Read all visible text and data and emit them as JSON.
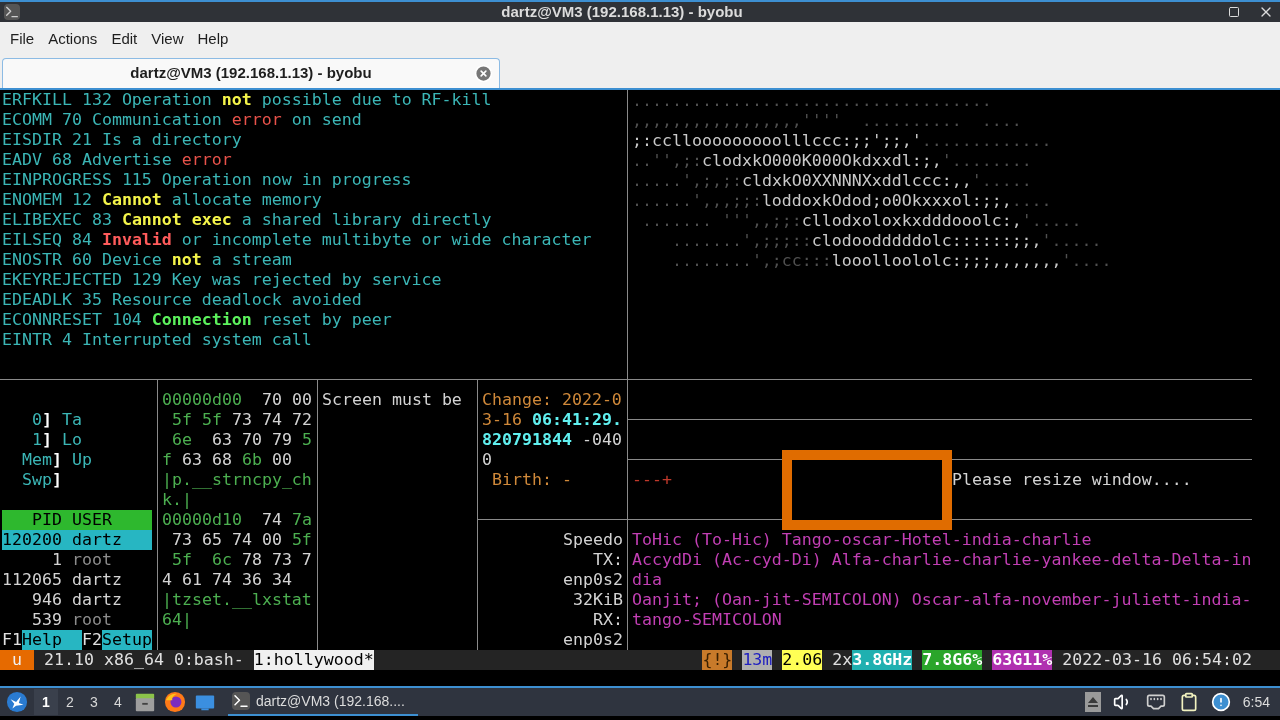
{
  "window": {
    "title": "dartz@VM3 (192.168.1.13) - byobu"
  },
  "menu": [
    "File",
    "Actions",
    "Edit",
    "View",
    "Help"
  ],
  "tabs": [
    {
      "label": "dartz@VM3 (192.168.1.13) - byobu",
      "selected": true
    }
  ],
  "errors": [
    [
      {
        "text": "ERFKILL 132 Operation ",
        "kind": "text"
      },
      {
        "text": "not",
        "kind": "warning"
      },
      {
        "text": " possible due to RF-kill",
        "kind": "text"
      }
    ],
    [
      {
        "text": "ECOMM 70 Communication ",
        "kind": "text"
      },
      {
        "text": "error",
        "kind": "error"
      },
      {
        "text": " on send",
        "kind": "text"
      }
    ],
    [
      {
        "text": "EISDIR 21 Is a directory",
        "kind": "text"
      }
    ],
    [
      {
        "text": "EADV 68 Advertise ",
        "kind": "text"
      },
      {
        "text": "error",
        "kind": "error"
      }
    ],
    [
      {
        "text": "EINPROGRESS 115 Operation now in progress",
        "kind": "text"
      }
    ],
    [
      {
        "text": "ENOMEM 12 ",
        "kind": "text"
      },
      {
        "text": "Cannot",
        "kind": "warning"
      },
      {
        "text": " allocate memory",
        "kind": "text"
      }
    ],
    [
      {
        "text": "ELIBEXEC 83 ",
        "kind": "text"
      },
      {
        "text": "Cannot exec",
        "kind": "warning"
      },
      {
        "text": " a shared library directly",
        "kind": "text"
      }
    ],
    [
      {
        "text": "EILSEQ 84 ",
        "kind": "text"
      },
      {
        "text": "Invalid",
        "kind": "critical"
      },
      {
        "text": " or incomplete multibyte or wide character",
        "kind": "text"
      }
    ],
    [
      {
        "text": "ENOSTR 60 Device ",
        "kind": "text"
      },
      {
        "text": "not",
        "kind": "warning"
      },
      {
        "text": " a stream",
        "kind": "text"
      }
    ],
    [
      {
        "text": "EKEYREJECTED 129 Key was rejected by service",
        "kind": "text"
      }
    ],
    [
      {
        "text": "EDEADLK 35 Resource deadlock avoided",
        "kind": "text"
      }
    ],
    [
      {
        "text": "ECONNRESET 104 ",
        "kind": "text"
      },
      {
        "text": "Connection",
        "kind": "success"
      },
      {
        "text": " reset by peer",
        "kind": "text"
      }
    ],
    [
      {
        "text": "EINTR 4 Interrupted system call",
        "kind": "text"
      }
    ]
  ],
  "art": [
    [
      {
        "text": "....................................",
        "kind": "faint"
      }
    ],
    [
      {
        "text": ",,,,,,,,,,,,,,,,,''''  ..........  ....",
        "kind": "faint"
      }
    ],
    [
      {
        "text": ";:ccllooooooooolllccc:;;';;,'",
        "kind": "shade"
      },
      {
        "text": ".............",
        "kind": "faint"
      }
    ],
    [
      {
        "text": "..'',;:",
        "kind": "faint"
      },
      {
        "text": "clodxkO000K000Okdxxdl:;,",
        "kind": "shade"
      },
      {
        "text": "'........",
        "kind": "faint"
      }
    ],
    [
      {
        "text": ".....',;,;:",
        "kind": "faint"
      },
      {
        "text": "cldxkO0XXNNNXxddlccc:,,",
        "kind": "shade"
      },
      {
        "text": "'.....",
        "kind": "faint"
      }
    ],
    [
      {
        "text": "......',,,;;:",
        "kind": "faint"
      },
      {
        "text": "loddoxkOdod;o0Okxxxol:;;,",
        "kind": "shade"
      },
      {
        "text": "....",
        "kind": "faint"
      }
    ],
    [
      {
        "text": " ....... ''',,;;:",
        "kind": "faint"
      },
      {
        "text": "cllodxoloxkxdddooolc:,",
        "kind": "shade"
      },
      {
        "text": "'.....",
        "kind": "faint"
      }
    ],
    [
      {
        "text": "    .......',;;;::",
        "kind": "faint"
      },
      {
        "text": "clodoodddddolc::::::;;,",
        "kind": "shade"
      },
      {
        "text": "'.....",
        "kind": "faint"
      }
    ],
    [
      {
        "text": "    ........',;cc:::",
        "kind": "faint"
      },
      {
        "text": "looolloololc:;;;,,,,,,,",
        "kind": "shade"
      },
      {
        "text": "'....",
        "kind": "faint"
      }
    ]
  ],
  "htop": {
    "meters": [
      [
        {
          "text": "   0",
          "kind": "text"
        },
        {
          "text": "]",
          "kind": "bracket"
        },
        {
          "text": " Ta",
          "kind": "text"
        }
      ],
      [
        {
          "text": "   1",
          "kind": "text"
        },
        {
          "text": "]",
          "kind": "bracket"
        },
        {
          "text": " Lo",
          "kind": "text"
        }
      ],
      [
        {
          "text": "  Mem",
          "kind": "text"
        },
        {
          "text": "]",
          "kind": "bracket"
        },
        {
          "text": " Up",
          "kind": "text"
        }
      ],
      [
        {
          "text": "  Swp",
          "kind": "text"
        },
        {
          "text": "]",
          "kind": "bracket"
        }
      ]
    ],
    "columns": "   PID USER",
    "processes": [
      {
        "pid": "120200",
        "user": "dartz",
        "selected": true,
        "dim": false
      },
      {
        "pid": "1",
        "user": "root",
        "selected": false,
        "dim": true
      },
      {
        "pid": "112065",
        "user": "dartz",
        "selected": false,
        "dim": false
      },
      {
        "pid": "946",
        "user": "dartz",
        "selected": false,
        "dim": false
      },
      {
        "pid": "539",
        "user": "root",
        "selected": false,
        "dim": true
      }
    ],
    "keys": [
      {
        "key": "F1",
        "label": "Help  "
      },
      {
        "key": "F2",
        "label": "Setup"
      }
    ]
  },
  "hexdump": [
    [
      {
        "text": "00000d00",
        "kind": "hex"
      },
      {
        "text": "  70 00",
        "kind": "plain"
      }
    ],
    [
      {
        "text": " 5f 5f",
        "kind": "hex"
      },
      {
        "text": " 73 74 72",
        "kind": "plain"
      }
    ],
    [
      {
        "text": " 6e",
        "kind": "hex"
      },
      {
        "text": "  63 70 79",
        "kind": "plain"
      },
      {
        "text": " 5",
        "kind": "hex"
      }
    ],
    [
      {
        "text": "f",
        "kind": "hex"
      },
      {
        "text": " 63 68",
        "kind": "plain"
      },
      {
        "text": " 6b",
        "kind": "hex"
      },
      {
        "text": " 00",
        "kind": "plain"
      }
    ],
    [
      {
        "text": "|p.__strncpy_ch",
        "kind": "hex"
      }
    ],
    [
      {
        "text": "k.|",
        "kind": "hex"
      }
    ],
    [
      {
        "text": "00000d10",
        "kind": "hex"
      },
      {
        "text": "  74",
        "kind": "plain"
      },
      {
        "text": " 7a",
        "kind": "hex"
      }
    ],
    [
      {
        "text": " 73 65 74 00",
        "kind": "plain"
      },
      {
        "text": " 5f",
        "kind": "hex"
      }
    ],
    [
      {
        "text": " 5f  6c",
        "kind": "hex"
      },
      {
        "text": " 78 73 7",
        "kind": "plain"
      }
    ],
    [
      {
        "text": "4 61 74 36 34",
        "kind": "plain"
      }
    ],
    [
      {
        "text": "|tzset.__lxstat",
        "kind": "hex"
      }
    ],
    [
      {
        "text": "64|",
        "kind": "hex"
      }
    ]
  ],
  "screen_pane": [
    [
      {
        "text": "Screen must be",
        "kind": "plain"
      }
    ]
  ],
  "stat": [
    [
      {
        "text": "Change: 2022-0",
        "kind": "label"
      }
    ],
    [
      {
        "text": "3-16 ",
        "kind": "label"
      },
      {
        "text": "06:41:29.",
        "kind": "value"
      }
    ],
    [
      {
        "text": "820791844",
        "kind": "value"
      },
      {
        "text": " -040",
        "kind": "plain"
      }
    ],
    [
      {
        "text": "0",
        "kind": "plain"
      }
    ],
    [
      {
        "text": " Birth: -",
        "kind": "label"
      }
    ]
  ],
  "resize": {
    "corner": "---+",
    "message": "Please resize window...."
  },
  "speedometer": [
    "Speedo",
    "TX:",
    "enp0s2",
    "32KiB",
    "RX:",
    "enp0s2"
  ],
  "phonetic": [
    "ToHic (To-Hic) Tango-oscar-Hotel-india-charlie",
    "AccydDi (Ac-cyd-Di) Alfa-charlie-charlie-yankee-delta-Delta-in",
    "dia",
    "Oanjit; (Oan-jit-SEMICOLON) Oscar-alfa-november-juliett-india-",
    "tango-SEMICOLON"
  ],
  "status_bar": {
    "session": "u",
    "info": "21.10 x86_64",
    "windows": [
      {
        "label": "0:bash-",
        "selected": false
      },
      {
        "label": "1:hollywood*",
        "selected": true
      }
    ],
    "right": [
      {
        "text": "{!}",
        "kind": "alert"
      },
      {
        "text": "13m",
        "kind": "uptime"
      },
      {
        "text": "2.06",
        "kind": "load"
      },
      {
        "label": "2x",
        "text": "3.8GHz",
        "kind": "cpu"
      },
      {
        "text": "7.8G6%",
        "kind": "memory"
      },
      {
        "text": "63G11%",
        "kind": "disk"
      },
      {
        "text": "2022-03-16 06:54:02",
        "kind": "clock"
      }
    ]
  },
  "taskbar": {
    "workspaces": [
      {
        "label": "1",
        "selected": true
      },
      {
        "label": "2",
        "selected": false
      },
      {
        "label": "3",
        "selected": false
      },
      {
        "label": "4",
        "selected": false
      }
    ],
    "task": "dartz@VM3 (192.168....",
    "clock": "6:54"
  }
}
